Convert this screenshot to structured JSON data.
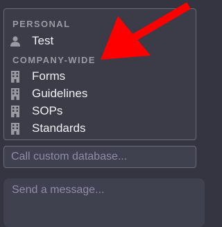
{
  "dropdown": {
    "sections": [
      {
        "label": "PERSONAL",
        "items": [
          {
            "label": "Test",
            "icon": "user-icon"
          }
        ]
      },
      {
        "label": "COMPANY-WIDE",
        "items": [
          {
            "label": "Forms",
            "icon": "building-icon"
          },
          {
            "label": "Guidelines",
            "icon": "building-icon"
          },
          {
            "label": "SOPs",
            "icon": "building-icon"
          },
          {
            "label": "Standards",
            "icon": "building-icon"
          }
        ]
      }
    ]
  },
  "database_input": {
    "placeholder": "Call custom database..."
  },
  "message_input": {
    "placeholder": "Send a message..."
  },
  "colors": {
    "annotation_arrow": "#ff0000",
    "background": "#343541"
  }
}
